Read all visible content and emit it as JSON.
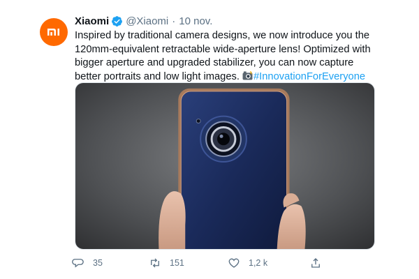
{
  "colors": {
    "brand_avatar": "#ff6900",
    "verified": "#1da1f2",
    "hashtag": "#1da1f2",
    "muted": "#5b7083"
  },
  "tweet": {
    "author_name": "Xiaomi",
    "handle": "@Xiaomi",
    "separator": "·",
    "date": "10 nov.",
    "text_before": "Inspired by traditional camera designs, we now introduce you the 120mm-equivalent retractable wide-aperture lens! Optimized with bigger aperture and upgraded stabilizer, you can now capture better portraits and low light images. ",
    "emoji": "camera-flash-emoji",
    "hashtag": "#InnovationForEveryone"
  },
  "avatar": {
    "icon": "mi-logo-icon"
  },
  "actions": {
    "reply": {
      "icon": "reply-icon",
      "count": "35"
    },
    "retweet": {
      "icon": "retweet-icon",
      "count": "151"
    },
    "like": {
      "icon": "heart-icon",
      "count": "1,2 k"
    },
    "share": {
      "icon": "share-icon"
    }
  }
}
